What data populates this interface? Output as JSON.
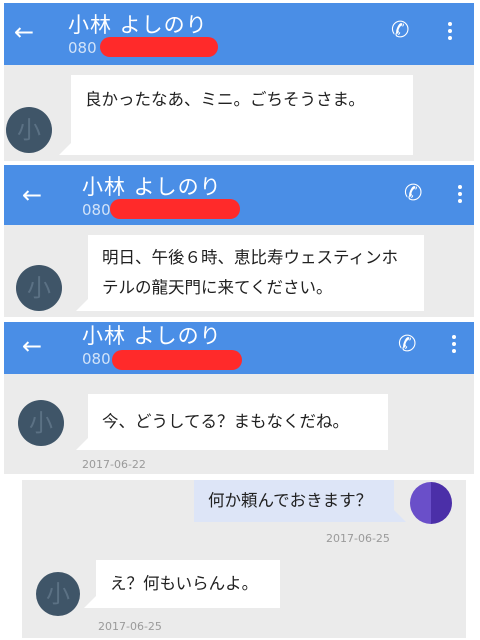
{
  "screens": [
    {
      "contact_name": "小林 よしのり",
      "phone_prefix": "080",
      "message": "良かったなあ、ミニ。ごちそうさま。"
    },
    {
      "contact_name": "小林 よしのり",
      "phone_prefix": "080",
      "message": "明日、午後６時、恵比寿ウェスティンホテルの龍天門に来てください。"
    },
    {
      "contact_name": "小林 よしのり",
      "phone_prefix": "080",
      "message": "今、どうしてる？まもなくだね。",
      "date": "2017-06-22"
    }
  ],
  "thread": [
    {
      "direction": "outgoing",
      "text": "何か頼んでおきます？",
      "date": "2017-06-25"
    },
    {
      "direction": "incoming",
      "text": "え？何もいらんよ。",
      "date": "2017-06-25"
    }
  ],
  "icons": {
    "back": "arrow-left",
    "call": "phone-handset",
    "menu": "three-dots-vertical",
    "avatar_glyph": "小"
  },
  "colors": {
    "appbar": "#4a8ee6",
    "background": "#ebebeb",
    "redaction": "#ff2a2a",
    "outgoing_bubble": "#dde5f7"
  }
}
